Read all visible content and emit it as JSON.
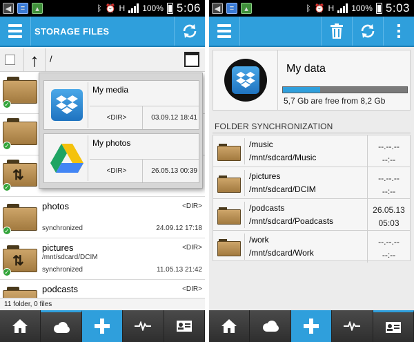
{
  "colors": {
    "accent": "#2f9fdc",
    "actionbar": "#2f9fdc",
    "nav_bg": "#3a3a3a",
    "folder": "#b88f52",
    "sync_ok": "#33a43a"
  },
  "left_screen": {
    "status_bar": {
      "battery": "100%",
      "time": "5:06",
      "net": "H",
      "icons": [
        "back-icon",
        "document-icon",
        "picture-icon",
        "bluetooth-icon",
        "alarm-icon",
        "signal-icon",
        "battery-icon"
      ]
    },
    "action_bar": {
      "title": "STORAGE FILES",
      "menu_icon": "menu-icon",
      "sync_icon": "refresh-icon"
    },
    "path_bar": {
      "path": "/"
    },
    "popup": {
      "items": [
        {
          "name": "My media",
          "type": "<DIR>",
          "date": "03.09.12 18:41",
          "icon": "dropbox-icon"
        },
        {
          "name": "My photos",
          "type": "<DIR>",
          "date": "26.05.13 00:39",
          "icon": "google-drive-icon"
        }
      ]
    },
    "files": [
      {
        "name": "photos",
        "path": "",
        "type": "<DIR>",
        "status": "synchronized",
        "date": "24.09.12 17:18",
        "icon": "folder-icon"
      },
      {
        "name": "pictures",
        "path": "/mnt/sdcard/DCIM",
        "type": "<DIR>",
        "status": "synchronized",
        "date": "11.05.13 21:42",
        "icon": "folder-sync-icon"
      },
      {
        "name": "podcasts",
        "path": "",
        "type": "<DIR>",
        "status": "",
        "date": "",
        "icon": "folder-icon"
      }
    ],
    "footer": "11 folder, 0 files",
    "nav": [
      "home-icon",
      "cloud-icon",
      "add-icon",
      "activity-icon",
      "contact-card-icon"
    ]
  },
  "right_screen": {
    "status_bar": {
      "battery": "100%",
      "time": "5:03",
      "net": "H"
    },
    "action_bar": {
      "menu_icon": "menu-icon",
      "actions": [
        "trash-icon",
        "refresh-icon",
        "overflow-icon"
      ]
    },
    "storage": {
      "title": "My data",
      "used_fraction": 0.3,
      "free_text": "5,7 Gb are free from 8,2 Gb",
      "icon": "dropbox-icon"
    },
    "sync_header": "FOLDER SYNCHRONIZATION",
    "sync_folders": [
      {
        "name": "/music",
        "path": "/mnt/sdcard/Music",
        "date": "--.--.--",
        "time": "--:--"
      },
      {
        "name": "/pictures",
        "path": "/mnt/sdcard/DCIM",
        "date": "--.--.--",
        "time": "--:--"
      },
      {
        "name": "/podcasts",
        "path": "/mnt/sdcard/Poadcasts",
        "date": "26.05.13",
        "time": "05:03"
      },
      {
        "name": "/work",
        "path": "/mnt/sdcard/Work",
        "date": "--.--.--",
        "time": "--:--"
      }
    ],
    "nav": [
      "home-icon",
      "cloud-icon",
      "add-icon",
      "activity-icon",
      "contact-card-icon"
    ]
  }
}
